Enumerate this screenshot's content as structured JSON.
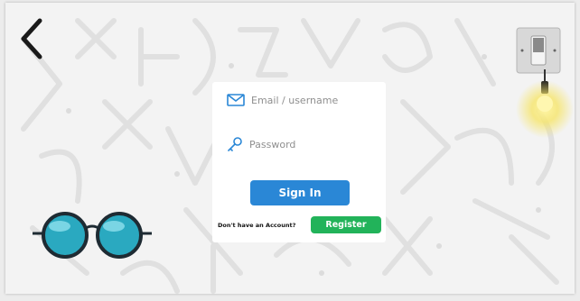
{
  "login": {
    "email_placeholder": "Email / username",
    "password_placeholder": "Password",
    "sign_in_label": "Sign In",
    "no_account_text": "Don't have an Account?",
    "register_label": "Register"
  },
  "icons": {
    "back": "chevron-left-icon",
    "email": "envelope-icon",
    "password": "key-icon",
    "decor_left": "glasses-icon",
    "light_switch": "light-switch-icon",
    "bulb": "light-bulb-icon"
  },
  "colors": {
    "background": "#f3f3f3",
    "doodle": "#e2e2e2",
    "sign_in_button": "#2a87d6",
    "register_button": "#22b35a",
    "icon_blue": "#2a87d6",
    "glasses_lens": "#2aa9c0",
    "bulb_glow": "#f6e56a"
  }
}
